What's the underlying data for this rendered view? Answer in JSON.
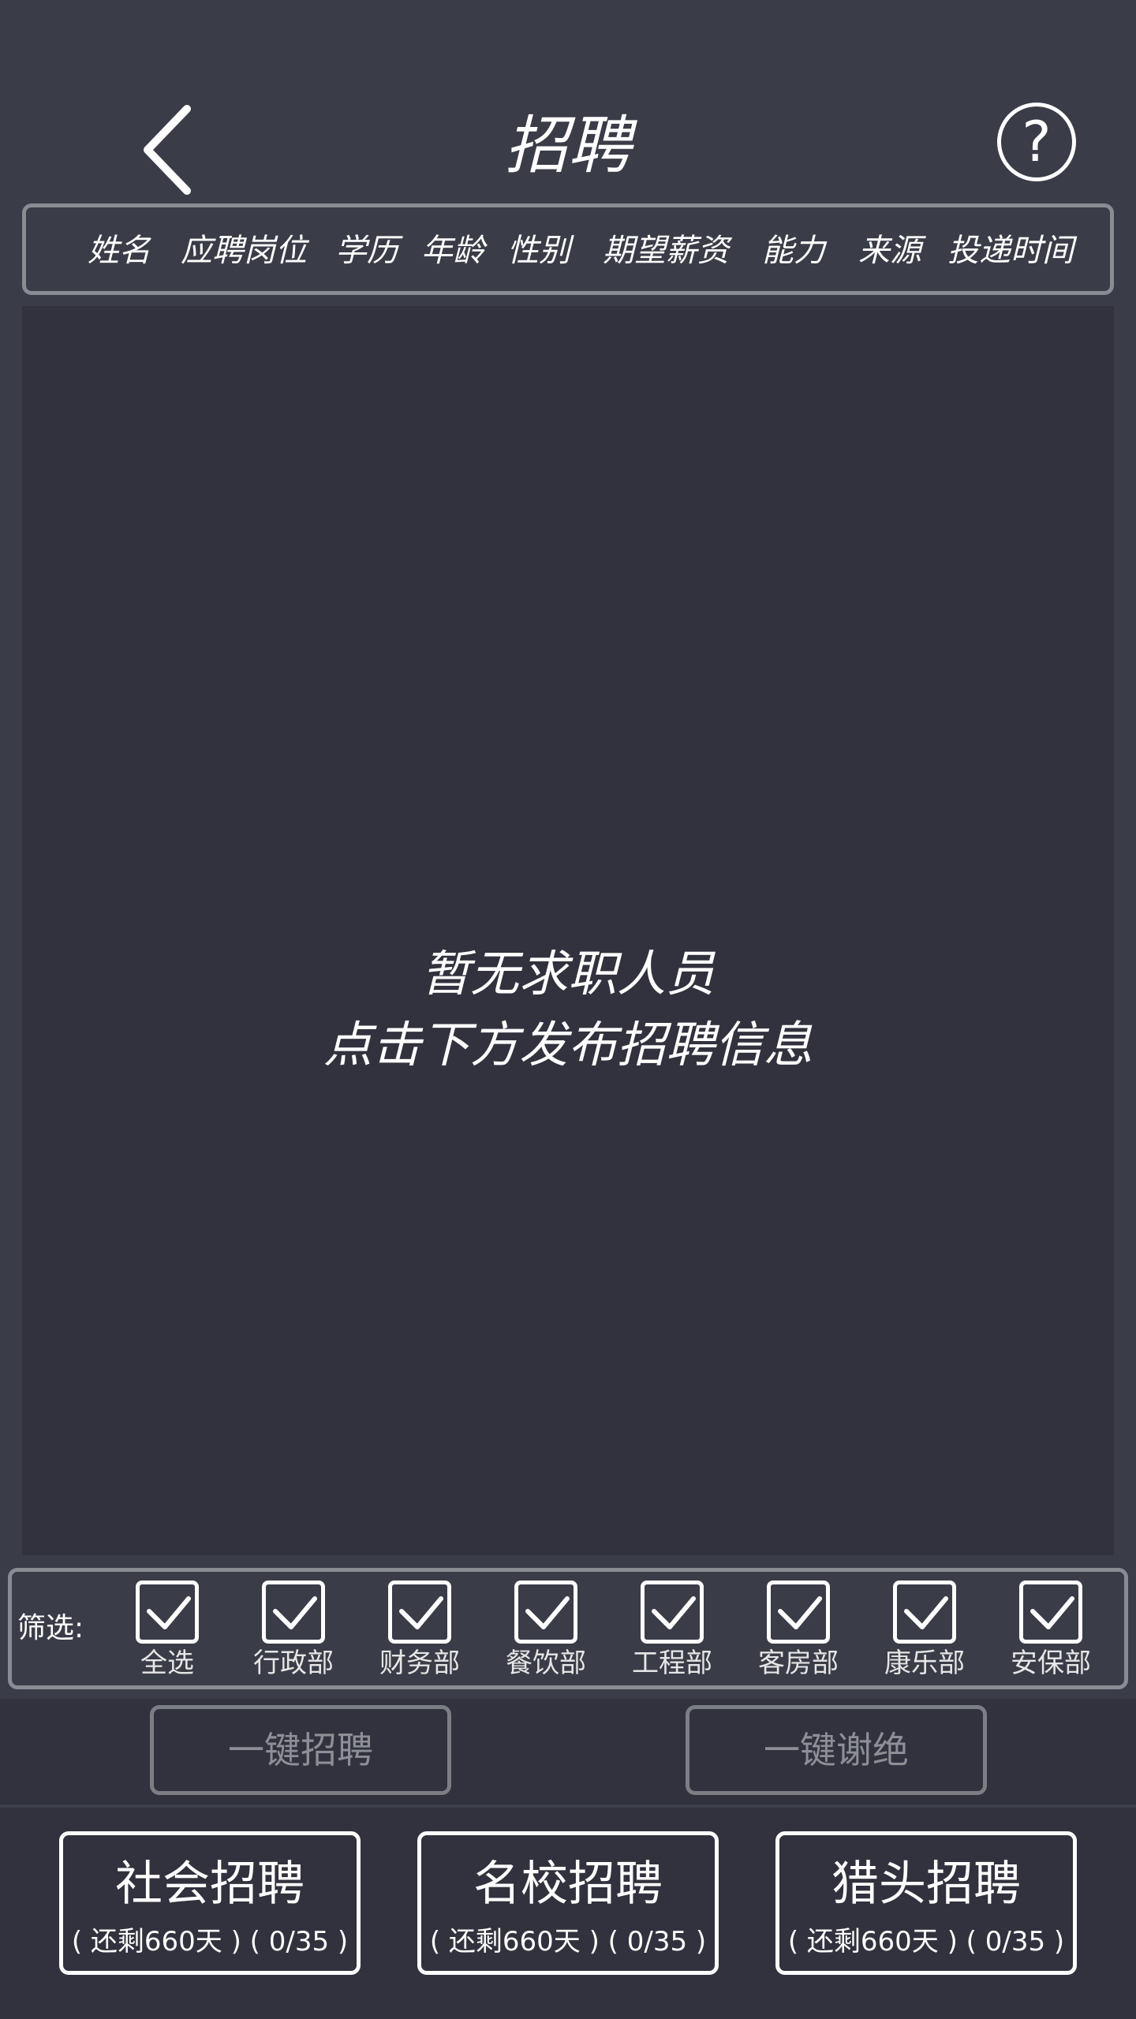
{
  "header": {
    "title": "招聘",
    "help_symbol": "?"
  },
  "columns": [
    "姓名",
    "应聘岗位",
    "学历",
    "年龄",
    "性别",
    "期望薪资",
    "能力",
    "来源",
    "投递时间"
  ],
  "empty_state": {
    "line1": "暂无求职人员",
    "line2": "点击下方发布招聘信息"
  },
  "filter": {
    "label": "筛选:",
    "items": [
      {
        "label": "全选",
        "checked": true
      },
      {
        "label": "行政部",
        "checked": true
      },
      {
        "label": "财务部",
        "checked": true
      },
      {
        "label": "餐饮部",
        "checked": true
      },
      {
        "label": "工程部",
        "checked": true
      },
      {
        "label": "客房部",
        "checked": true
      },
      {
        "label": "康乐部",
        "checked": true
      },
      {
        "label": "安保部",
        "checked": true
      }
    ]
  },
  "actions": {
    "hire_all": "一键招聘",
    "reject_all": "一键谢绝"
  },
  "recruit_channels": [
    {
      "title": "社会招聘",
      "sub": "( 还剩660天 ) ( 0/35 )"
    },
    {
      "title": "名校招聘",
      "sub": "( 还剩660天 ) ( 0/35 )"
    },
    {
      "title": "猎头招聘",
      "sub": "( 还剩660天 ) ( 0/35 )"
    }
  ],
  "icons": {
    "back": "chevron-left-icon",
    "help": "question-circle-icon",
    "checkbox": "check-icon"
  },
  "colors": {
    "background": "#3a3d48",
    "list_background": "#31323d",
    "border": "#8a8c94",
    "disabled_text": "#8d8f96"
  }
}
